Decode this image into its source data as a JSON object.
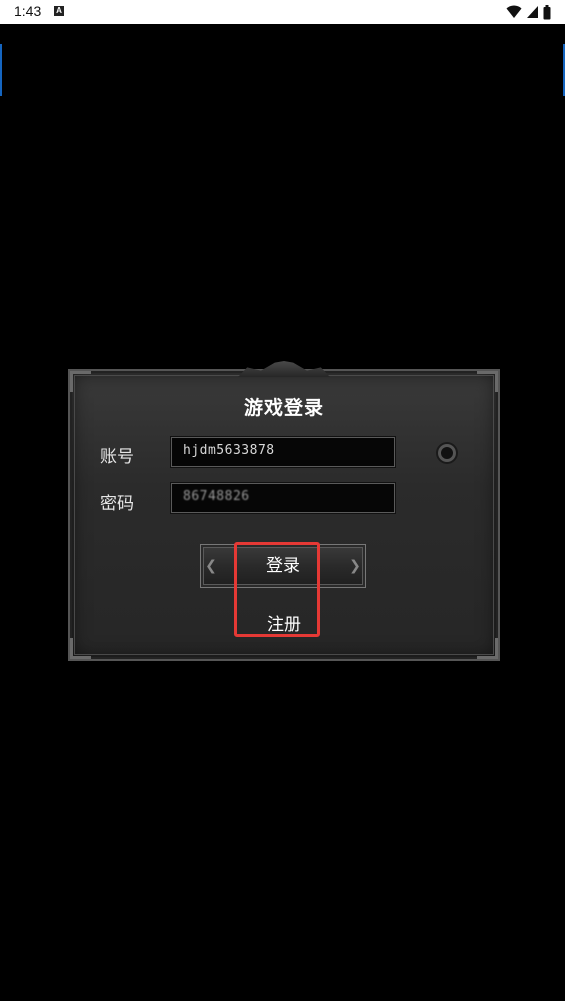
{
  "status_bar": {
    "time": "1:43",
    "notification_icon": "A",
    "icons": [
      "wifi-icon",
      "signal-icon",
      "battery-icon"
    ]
  },
  "login_panel": {
    "title": "游戏登录",
    "account_label": "账号",
    "account_value": "hjdm5633878",
    "password_label": "密码",
    "password_value": "86748826",
    "login_button_label": "登录",
    "register_link_label": "注册"
  },
  "annotation": {
    "highlight_color": "#e53935"
  }
}
